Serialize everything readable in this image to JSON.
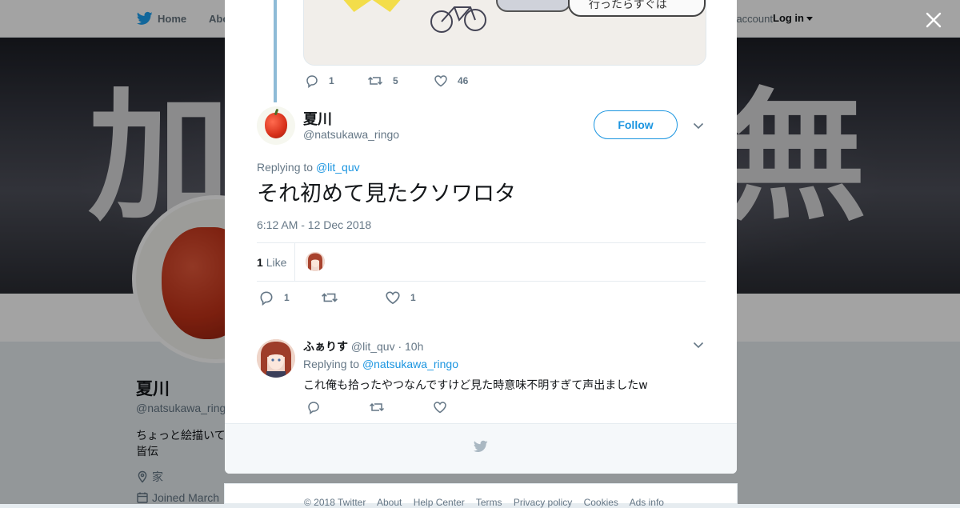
{
  "topbar": {
    "home": "Home",
    "about": "Abo",
    "account": "Have an account?",
    "login": "Log in"
  },
  "banner": {
    "left_char": "加",
    "right_char": "無"
  },
  "profile": {
    "name": "夏川",
    "handle": "@natsukawa_ringo",
    "bio_line1": "ちょっと絵描いて",
    "bio_line2": "皆伝",
    "location": "家",
    "joined": "Joined March"
  },
  "prev_tweet": {
    "bubble_text": "行ったらすぐは",
    "replies": "1",
    "retweets": "5",
    "likes": "46"
  },
  "main_tweet": {
    "name": "夏川",
    "handle": "@natsukawa_ringo",
    "follow_label": "Follow",
    "replying_prefix": "Replying to",
    "replying_to": "@lit_quv",
    "text": "それ初めて見たクソワロタ",
    "timestamp": "6:12 AM - 12 Dec 2018",
    "like_count": "1",
    "like_label": "Like",
    "replies": "1",
    "retweets": "",
    "likes": "1"
  },
  "reply_tweet": {
    "name": "ふぁりす",
    "handle": "@lit_quv",
    "time": "· 10h",
    "replying_prefix": "Replying to",
    "replying_to": "@natsukawa_ringo",
    "text": "これ俺も拾ったやつなんですけど見た時意味不明すぎて声出ましたw"
  },
  "footer": {
    "links": [
      "© 2018 Twitter",
      "About",
      "Help Center",
      "Terms",
      "Privacy policy",
      "Cookies",
      "Ads info"
    ]
  },
  "colors": {
    "accent": "#1b95e0",
    "muted": "#657786",
    "thread_line": "#8ebbd7"
  },
  "icons": {
    "close": "close-icon",
    "logo": "twitter-bird-icon",
    "reply": "reply-icon",
    "retweet": "retweet-icon",
    "like": "heart-icon",
    "more": "chevron-down-icon"
  }
}
